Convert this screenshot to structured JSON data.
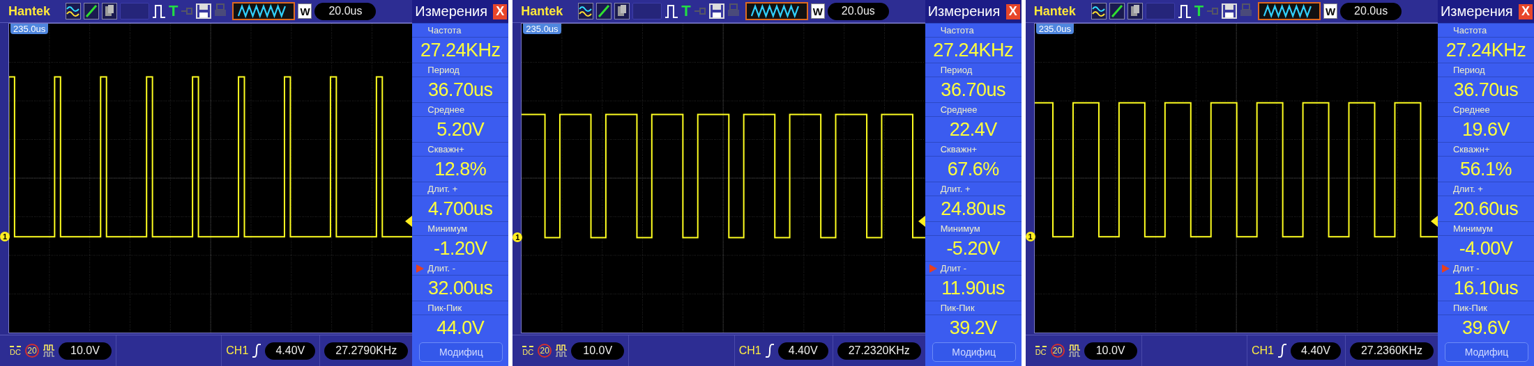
{
  "panels": [
    {
      "brand": "Hantek",
      "trigger_mark": "T",
      "zoom_button": "W",
      "timebase": "20.0us",
      "trigger_position": "235.0us",
      "channel_marker": "1",
      "measure_title": "Измерения",
      "close": "X",
      "measurements": [
        {
          "label": "Частота",
          "value": "27.24KHz",
          "selected": false
        },
        {
          "label": "Период",
          "value": "36.70us",
          "selected": false
        },
        {
          "label": "Среднее",
          "value": "5.20V",
          "selected": false
        },
        {
          "label": "Скважн+",
          "value": "12.8%",
          "selected": false
        },
        {
          "label": "Длит. +",
          "value": "4.700us",
          "selected": false
        },
        {
          "label": "Минимум",
          "value": "-1.20V",
          "selected": false
        },
        {
          "label": "Длит. -",
          "value": "32.00us",
          "selected": true
        },
        {
          "label": "Пик-Пик",
          "value": "44.0V",
          "selected": false
        }
      ],
      "modify_button": "Модифиц",
      "coupling": "DC",
      "bandwidth_limit": "20",
      "volts_per_div": "10.0V",
      "trigger_channel": "CH1",
      "trigger_level": "4.40V",
      "frequency": "27.2790KHz"
    },
    {
      "brand": "Hantek",
      "trigger_mark": "T",
      "zoom_button": "W",
      "timebase": "20.0us",
      "trigger_position": "235.0us",
      "channel_marker": "1",
      "measure_title": "Измерения",
      "close": "X",
      "measurements": [
        {
          "label": "Частота",
          "value": "27.24KHz",
          "selected": false
        },
        {
          "label": "Период",
          "value": "36.70us",
          "selected": false
        },
        {
          "label": "Среднее",
          "value": "22.4V",
          "selected": false
        },
        {
          "label": "Скважн+",
          "value": "67.6%",
          "selected": false
        },
        {
          "label": "Длит. +",
          "value": "24.80us",
          "selected": false
        },
        {
          "label": "Минимум",
          "value": "-5.20V",
          "selected": false
        },
        {
          "label": "Длит -",
          "value": "11.90us",
          "selected": true
        },
        {
          "label": "Пик-Пик",
          "value": "39.2V",
          "selected": false
        }
      ],
      "modify_button": "Модифиц",
      "coupling": "DC",
      "bandwidth_limit": "20",
      "volts_per_div": "10.0V",
      "trigger_channel": "CH1",
      "trigger_level": "4.40V",
      "frequency": "27.2320KHz"
    },
    {
      "brand": "Hantek",
      "trigger_mark": "T",
      "zoom_button": "W",
      "timebase": "20.0us",
      "trigger_position": "235.0us",
      "channel_marker": "1",
      "measure_title": "Измерения",
      "close": "X",
      "measurements": [
        {
          "label": "Частота",
          "value": "27.24KHz",
          "selected": false
        },
        {
          "label": "Период",
          "value": "36.70us",
          "selected": false
        },
        {
          "label": "Среднее",
          "value": "19.6V",
          "selected": false
        },
        {
          "label": "Скважн+",
          "value": "56.1%",
          "selected": false
        },
        {
          "label": "Длит. +",
          "value": "20.60us",
          "selected": false
        },
        {
          "label": "Минимум",
          "value": "-4.00V",
          "selected": false
        },
        {
          "label": "Длит -",
          "value": "16.10us",
          "selected": true
        },
        {
          "label": "Пик-Пик",
          "value": "39.6V",
          "selected": false
        }
      ],
      "modify_button": "Модифиц",
      "coupling": "DC",
      "bandwidth_limit": "20",
      "volts_per_div": "10.0V",
      "trigger_channel": "CH1",
      "trigger_level": "4.40V",
      "frequency": "27.2360KHz"
    }
  ]
}
